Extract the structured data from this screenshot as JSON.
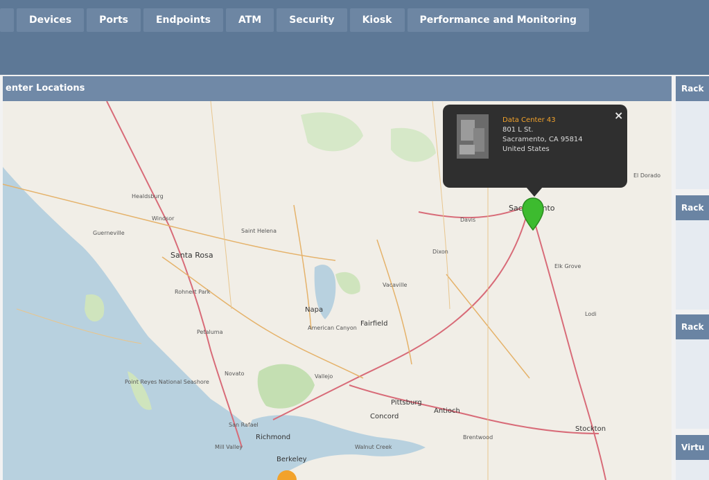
{
  "nav": {
    "tabs": [
      "Devices",
      "Ports",
      "Endpoints",
      "ATM",
      "Security",
      "Kiosk",
      "Performance and Monitoring"
    ]
  },
  "panel": {
    "title": "enter Locations"
  },
  "popup": {
    "name": "Data Center 43",
    "address_line1": "801 L St.",
    "address_line2": "Sacramento, CA 95814",
    "country": "United States",
    "close_label": "×"
  },
  "map": {
    "labels": [
      "Healdsburg",
      "Windsor",
      "Guerneville",
      "Santa Rosa",
      "Saint Helena",
      "Rohnert Park",
      "Napa",
      "Petaluma",
      "Vacaville",
      "Fairfield",
      "Davis",
      "Sacramento",
      "Elk Grove",
      "Lodi",
      "Vallejo",
      "Novato",
      "Pittsburg",
      "Antioch",
      "Concord",
      "Stockton",
      "Richmond",
      "Berkeley",
      "Walnut Creek",
      "Brentwood",
      "Mill Valley",
      "San Rafael",
      "Point Reyes National Seashore",
      "American Canyon",
      "Dixon",
      "El Dorado"
    ]
  },
  "right_panels": [
    {
      "title": "Rack"
    },
    {
      "title": "Rack"
    },
    {
      "title": "Rack"
    },
    {
      "title": "Virtu"
    }
  ],
  "colors": {
    "topbar": "#5d7896",
    "tab": "#6d86a3",
    "panel_header": "#7089a7",
    "pin": "#3dbb2f",
    "popup_bg": "#2f2f2f",
    "popup_name": "#f2a22b"
  }
}
